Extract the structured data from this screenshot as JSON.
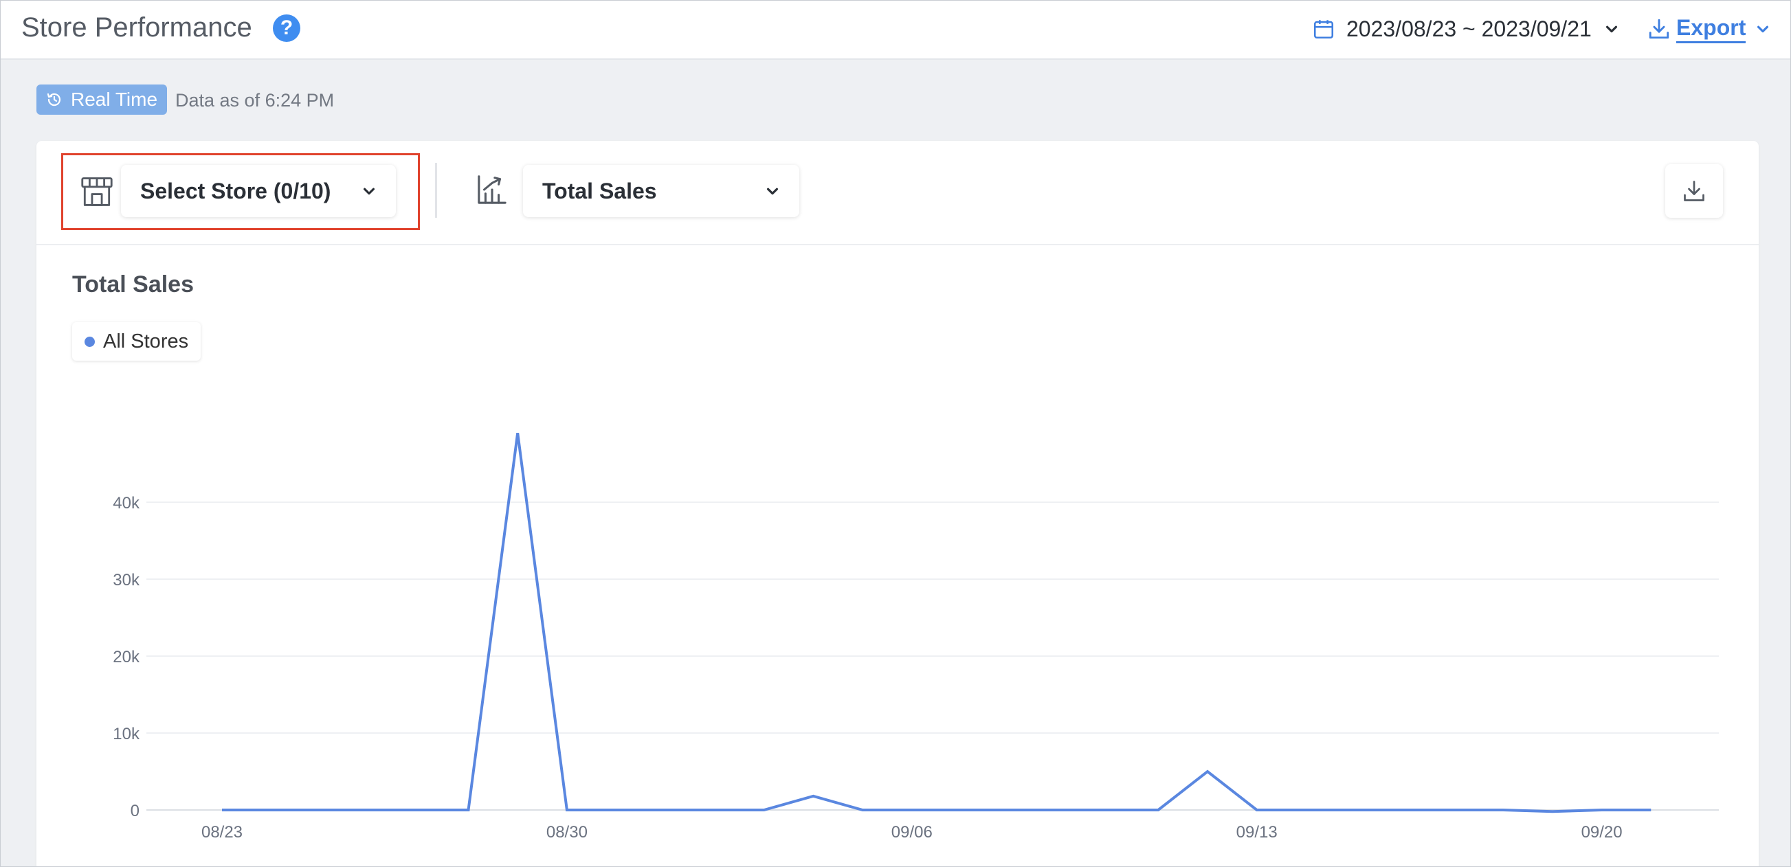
{
  "header": {
    "title": "Store Performance",
    "help_icon": "question-circle-icon",
    "date_range": "2023/08/23 ~ 2023/09/21",
    "export_label": "Export"
  },
  "realtime": {
    "badge_label": "Real Time",
    "status_text": "Data as of 6:24 PM"
  },
  "toolbar": {
    "store_select_label": "Select Store (0/10)",
    "metric_select_label": "Total Sales"
  },
  "colors": {
    "accent": "#3f7fe0",
    "series": "#5a87e0",
    "highlight_border": "#e0432d",
    "badge": "#80aee8"
  },
  "chart_data": {
    "type": "line",
    "title": "Total Sales",
    "legend": [
      "All Stores"
    ],
    "x": [
      "08/23",
      "08/24",
      "08/25",
      "08/26",
      "08/27",
      "08/28",
      "08/29",
      "08/30",
      "08/31",
      "09/01",
      "09/02",
      "09/03",
      "09/04",
      "09/05",
      "09/06",
      "09/07",
      "09/08",
      "09/09",
      "09/10",
      "09/11",
      "09/12",
      "09/13",
      "09/14",
      "09/15",
      "09/16",
      "09/17",
      "09/18",
      "09/19",
      "09/20",
      "09/21"
    ],
    "x_tick_labels": [
      "08/23",
      "08/30",
      "09/06",
      "09/13",
      "09/20"
    ],
    "series": [
      {
        "name": "All Stores",
        "values": [
          0,
          0,
          0,
          0,
          0,
          0,
          49000,
          0,
          0,
          0,
          0,
          0,
          1800,
          0,
          0,
          0,
          0,
          0,
          0,
          0,
          5000,
          0,
          0,
          0,
          0,
          0,
          0,
          -200,
          0,
          0
        ]
      }
    ],
    "y_ticks": [
      0,
      10000,
      20000,
      30000,
      40000
    ],
    "y_tick_labels": [
      "0",
      "10k",
      "20k",
      "30k",
      "40k"
    ],
    "ylim": [
      0,
      50000
    ],
    "grid": true
  }
}
